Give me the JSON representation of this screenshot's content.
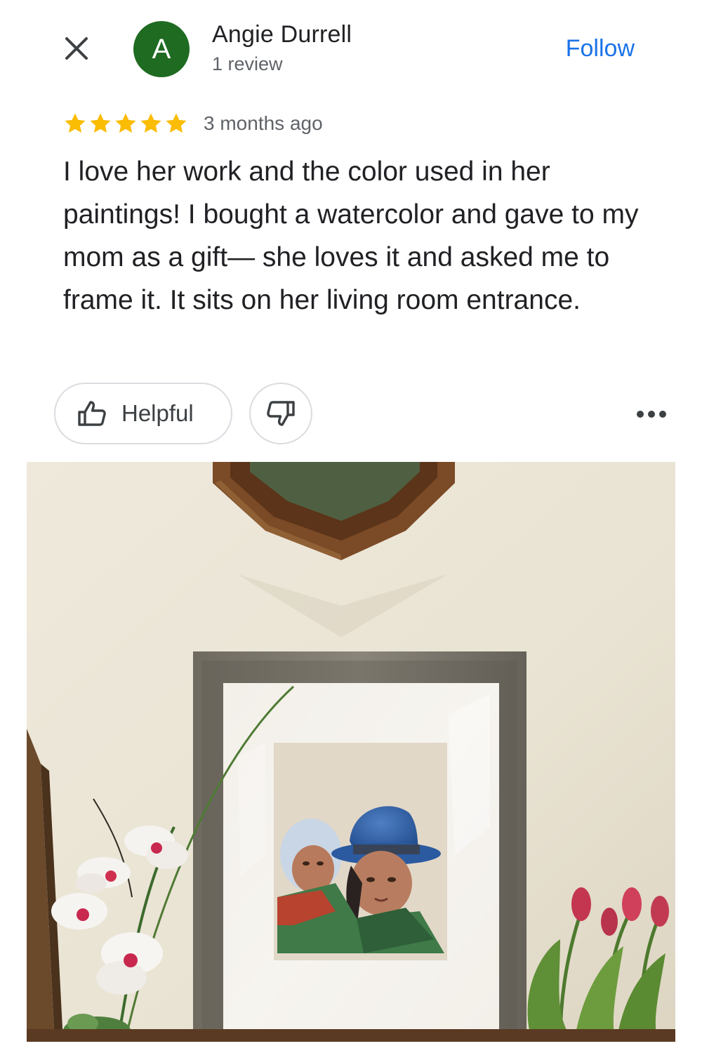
{
  "header": {
    "close_icon": "close-icon",
    "avatar_letter": "A",
    "avatar_color": "#1e6b21",
    "reviewer_name": "Angie Durrell",
    "review_count": "1 review",
    "follow_label": "Follow",
    "accent_color": "#1a73e8"
  },
  "review": {
    "rating": 5,
    "rating_max": 5,
    "star_color": "#fbbc04",
    "date": "3 months ago",
    "text": "I love her work and the color used in her paintings! I bought a watercolor and gave to my mom as a gift— she loves it and asked me to frame it. It sits on her living room entrance."
  },
  "actions": {
    "helpful_label": "Helpful",
    "helpful_icon": "thumbs-up-icon",
    "unhelpful_icon": "thumbs-down-icon",
    "more_icon": "more-options-icon"
  },
  "photo": {
    "subject": "framed watercolor painting of two children in hats, on a table with orchids and tulips"
  }
}
